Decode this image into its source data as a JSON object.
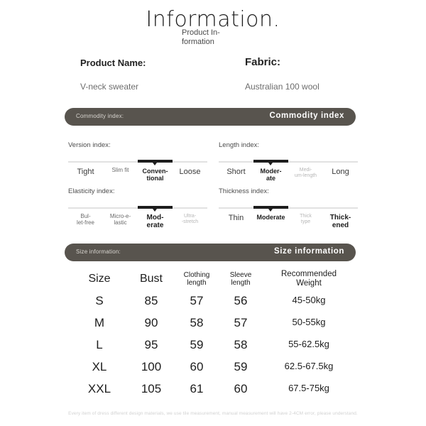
{
  "header": {
    "title": "Information.",
    "subtitle": "Product In-\nformation"
  },
  "fields": {
    "product_name_label": "Product Name:",
    "product_name_value": "V-neck sweater",
    "fabric_label": "Fabric:",
    "fabric_value": "Australian 100 wool"
  },
  "commodity_bar": {
    "left_label": "Commodity index:",
    "right_label": "Commodity index"
  },
  "size_bar": {
    "left_label": "Size information:",
    "right_label": "Size information"
  },
  "indexes": [
    {
      "title": "Version index:",
      "selected": 2,
      "options": [
        {
          "label": "Tight",
          "style": "big"
        },
        {
          "label": "Slim fit",
          "style": "med"
        },
        {
          "label": "Conven-\ntional",
          "style": "sel"
        },
        {
          "label": "Loose",
          "style": "big"
        }
      ]
    },
    {
      "title": "Length index:",
      "selected": 1,
      "options": [
        {
          "label": "Short",
          "style": "big"
        },
        {
          "label": "Moder-\nate",
          "style": "sel"
        },
        {
          "label": "Medi-\num-length",
          "style": "faint"
        },
        {
          "label": "Long",
          "style": "big"
        }
      ]
    },
    {
      "title": "Elasticity index:",
      "selected": 2,
      "options": [
        {
          "label": "Bul-\nlet-free",
          "style": "med"
        },
        {
          "label": "Micro-e-\nlastic",
          "style": "med"
        },
        {
          "label": "Mod-\nerate",
          "style": "selbig"
        },
        {
          "label": "Ultra-\n-stretch",
          "style": "faint"
        }
      ]
    },
    {
      "title": "Thickness index:",
      "selected": 1,
      "options": [
        {
          "label": "Thin",
          "style": "big"
        },
        {
          "label": "Moderate",
          "style": "sel"
        },
        {
          "label": "Thick\ntype",
          "style": "faint"
        },
        {
          "label": "Thick-\nened",
          "style": "selbig"
        }
      ]
    }
  ],
  "size_table": {
    "headers": [
      "Size",
      "Bust",
      "Clothing\nlength",
      "Sleeve\nlength",
      "Recommended\nWeight"
    ],
    "rows": [
      [
        "S",
        "85",
        "57",
        "56",
        "45-50kg"
      ],
      [
        "M",
        "90",
        "58",
        "57",
        "50-55kg"
      ],
      [
        "L",
        "95",
        "59",
        "58",
        "55-62.5kg"
      ],
      [
        "XL",
        "100",
        "60",
        "59",
        "62.5-67.5kg"
      ],
      [
        "XXL",
        "105",
        "61",
        "60",
        "67.5-75kg"
      ]
    ]
  },
  "footer": {
    "disclaimer": "Every item of dress different design materials, we use tile measurement, manual measurement will have 2-4CM error, please understand."
  },
  "colors": {
    "bar_bg": "#58544e",
    "marker": "#1d1d1d",
    "track": "#e2e2e2"
  }
}
